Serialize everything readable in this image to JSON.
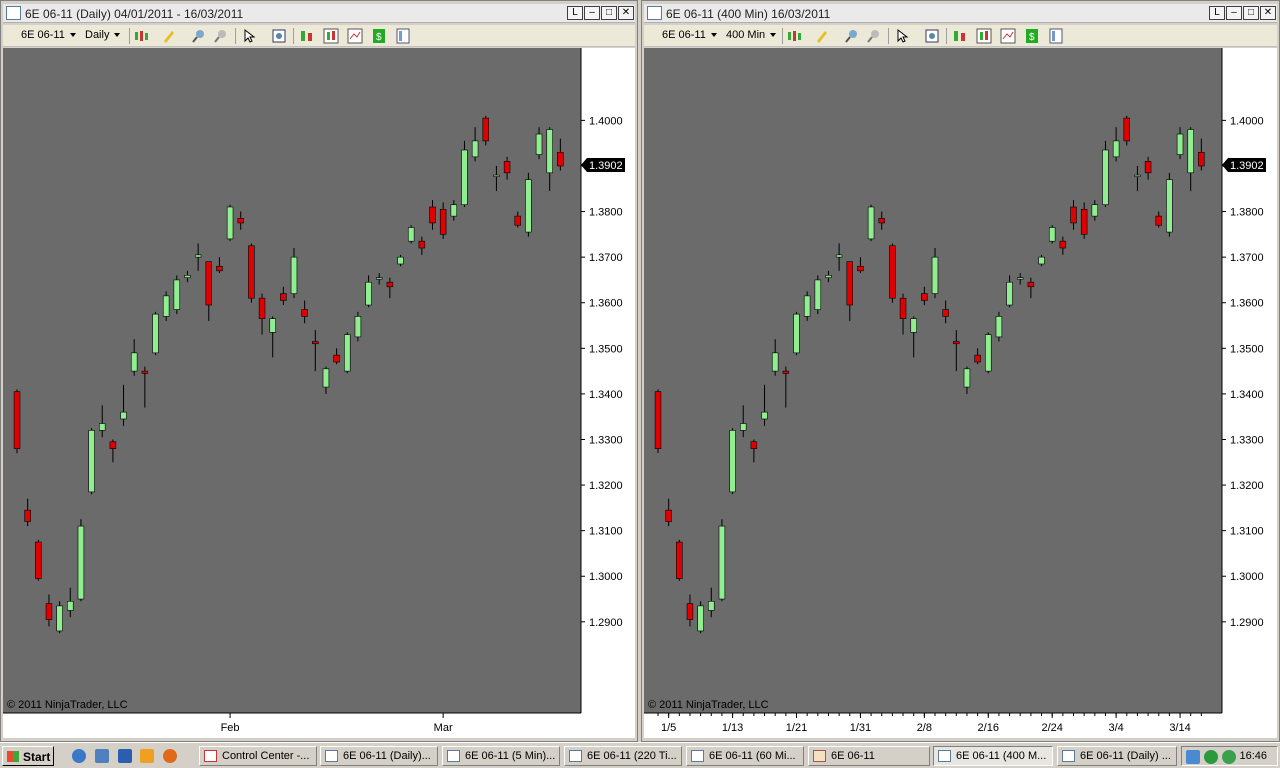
{
  "windows": [
    {
      "title": "6E 06-11 (Daily)  04/01/2011 - 16/03/2011",
      "instrument": "6E 06-11",
      "interval": "Daily",
      "last_price": "1.3902",
      "copyright": "© 2011 NinjaTrader, LLC",
      "x_labels": [
        {
          "i": 20,
          "label": "Feb"
        },
        {
          "i": 40,
          "label": "Mar"
        }
      ]
    },
    {
      "title": "6E 06-11 (400 Min)  16/03/2011",
      "instrument": "6E 06-11",
      "interval": "400 Min",
      "last_price": "1.3902",
      "copyright": "© 2011 NinjaTrader, LLC",
      "x_labels": [
        {
          "i": 1,
          "label": "1/5"
        },
        {
          "i": 7,
          "label": "1/13"
        },
        {
          "i": 13,
          "label": "1/21"
        },
        {
          "i": 19,
          "label": "1/31"
        },
        {
          "i": 25,
          "label": "2/8"
        },
        {
          "i": 31,
          "label": "2/16"
        },
        {
          "i": 37,
          "label": "2/24"
        },
        {
          "i": 43,
          "label": "3/4"
        },
        {
          "i": 49,
          "label": "3/14"
        }
      ]
    }
  ],
  "chart_data": {
    "type": "candlestick",
    "ylim": [
      1.27,
      1.415
    ],
    "y_ticks": [
      "1.4000",
      "1.3900",
      "1.3800",
      "1.3700",
      "1.3600",
      "1.3500",
      "1.3400",
      "1.3300",
      "1.3200",
      "1.3100",
      "1.3000",
      "1.2900"
    ],
    "up_color": "#90ee90",
    "down_color": "#e00000",
    "background": "#6b6b6b",
    "candles": [
      {
        "o": 1.3405,
        "h": 1.341,
        "l": 1.327,
        "c": 1.328
      },
      {
        "o": 1.3145,
        "h": 1.317,
        "l": 1.311,
        "c": 1.312
      },
      {
        "o": 1.3075,
        "h": 1.308,
        "l": 1.299,
        "c": 1.2995
      },
      {
        "o": 1.294,
        "h": 1.296,
        "l": 1.289,
        "c": 1.2905
      },
      {
        "o": 1.288,
        "h": 1.2945,
        "l": 1.2875,
        "c": 1.2935
      },
      {
        "o": 1.2925,
        "h": 1.2975,
        "l": 1.291,
        "c": 1.2945
      },
      {
        "o": 1.295,
        "h": 1.3125,
        "l": 1.2945,
        "c": 1.311
      },
      {
        "o": 1.3185,
        "h": 1.3325,
        "l": 1.318,
        "c": 1.332
      },
      {
        "o": 1.332,
        "h": 1.3375,
        "l": 1.3305,
        "c": 1.3335
      },
      {
        "o": 1.3295,
        "h": 1.33,
        "l": 1.325,
        "c": 1.328
      },
      {
        "o": 1.3345,
        "h": 1.342,
        "l": 1.333,
        "c": 1.336
      },
      {
        "o": 1.345,
        "h": 1.352,
        "l": 1.344,
        "c": 1.349
      },
      {
        "o": 1.345,
        "h": 1.346,
        "l": 1.337,
        "c": 1.3445
      },
      {
        "o": 1.349,
        "h": 1.358,
        "l": 1.3485,
        "c": 1.3575
      },
      {
        "o": 1.357,
        "h": 1.3625,
        "l": 1.356,
        "c": 1.3615
      },
      {
        "o": 1.3585,
        "h": 1.366,
        "l": 1.3575,
        "c": 1.365
      },
      {
        "o": 1.3655,
        "h": 1.367,
        "l": 1.3645,
        "c": 1.366
      },
      {
        "o": 1.37,
        "h": 1.373,
        "l": 1.367,
        "c": 1.3705
      },
      {
        "o": 1.369,
        "h": 1.369,
        "l": 1.356,
        "c": 1.3595
      },
      {
        "o": 1.368,
        "h": 1.37,
        "l": 1.3665,
        "c": 1.367
      },
      {
        "o": 1.374,
        "h": 1.3815,
        "l": 1.3735,
        "c": 1.381
      },
      {
        "o": 1.3785,
        "h": 1.38,
        "l": 1.376,
        "c": 1.3775
      },
      {
        "o": 1.3725,
        "h": 1.373,
        "l": 1.36,
        "c": 1.361
      },
      {
        "o": 1.361,
        "h": 1.362,
        "l": 1.353,
        "c": 1.3565
      },
      {
        "o": 1.3535,
        "h": 1.357,
        "l": 1.348,
        "c": 1.3565
      },
      {
        "o": 1.362,
        "h": 1.3635,
        "l": 1.3595,
        "c": 1.3605
      },
      {
        "o": 1.362,
        "h": 1.372,
        "l": 1.361,
        "c": 1.37
      },
      {
        "o": 1.3585,
        "h": 1.3605,
        "l": 1.3555,
        "c": 1.357
      },
      {
        "o": 1.3515,
        "h": 1.354,
        "l": 1.345,
        "c": 1.351
      },
      {
        "o": 1.3415,
        "h": 1.346,
        "l": 1.34,
        "c": 1.3455
      },
      {
        "o": 1.3485,
        "h": 1.35,
        "l": 1.3465,
        "c": 1.347
      },
      {
        "o": 1.345,
        "h": 1.3535,
        "l": 1.3445,
        "c": 1.353
      },
      {
        "o": 1.3525,
        "h": 1.358,
        "l": 1.3515,
        "c": 1.357
      },
      {
        "o": 1.3595,
        "h": 1.366,
        "l": 1.359,
        "c": 1.3645
      },
      {
        "o": 1.3655,
        "h": 1.3665,
        "l": 1.364,
        "c": 1.3655
      },
      {
        "o": 1.3645,
        "h": 1.3655,
        "l": 1.361,
        "c": 1.3635
      },
      {
        "o": 1.3685,
        "h": 1.3705,
        "l": 1.368,
        "c": 1.37
      },
      {
        "o": 1.3735,
        "h": 1.377,
        "l": 1.373,
        "c": 1.3765
      },
      {
        "o": 1.3735,
        "h": 1.3745,
        "l": 1.3705,
        "c": 1.372
      },
      {
        "o": 1.381,
        "h": 1.3825,
        "l": 1.376,
        "c": 1.3775
      },
      {
        "o": 1.3805,
        "h": 1.382,
        "l": 1.374,
        "c": 1.375
      },
      {
        "o": 1.379,
        "h": 1.3825,
        "l": 1.378,
        "c": 1.3815
      },
      {
        "o": 1.3815,
        "h": 1.3955,
        "l": 1.381,
        "c": 1.3935
      },
      {
        "o": 1.392,
        "h": 1.3985,
        "l": 1.391,
        "c": 1.3955
      },
      {
        "o": 1.4005,
        "h": 1.401,
        "l": 1.3945,
        "c": 1.3955
      },
      {
        "o": 1.388,
        "h": 1.39,
        "l": 1.3845,
        "c": 1.388
      },
      {
        "o": 1.391,
        "h": 1.392,
        "l": 1.387,
        "c": 1.3885
      },
      {
        "o": 1.379,
        "h": 1.38,
        "l": 1.3765,
        "c": 1.377
      },
      {
        "o": 1.3755,
        "h": 1.3885,
        "l": 1.3745,
        "c": 1.387
      },
      {
        "o": 1.3925,
        "h": 1.3985,
        "l": 1.3915,
        "c": 1.397
      },
      {
        "o": 1.3885,
        "h": 1.3985,
        "l": 1.3845,
        "c": 1.398
      },
      {
        "o": 1.393,
        "h": 1.396,
        "l": 1.389,
        "c": 1.39
      }
    ]
  },
  "taskbar": {
    "start_label": "Start",
    "buttons": [
      {
        "label": "Control Center -..."
      },
      {
        "label": "6E 06-11 (Daily)..."
      },
      {
        "label": "6E 06-11 (5 Min)..."
      },
      {
        "label": "6E 06-11 (220 Ti..."
      },
      {
        "label": "6E 06-11 (60 Mi..."
      },
      {
        "label": "6E 06-11"
      },
      {
        "label": "6E 06-11 (400 M..."
      },
      {
        "label": "6E 06-11 (Daily) ..."
      }
    ],
    "clock": "16:46"
  }
}
